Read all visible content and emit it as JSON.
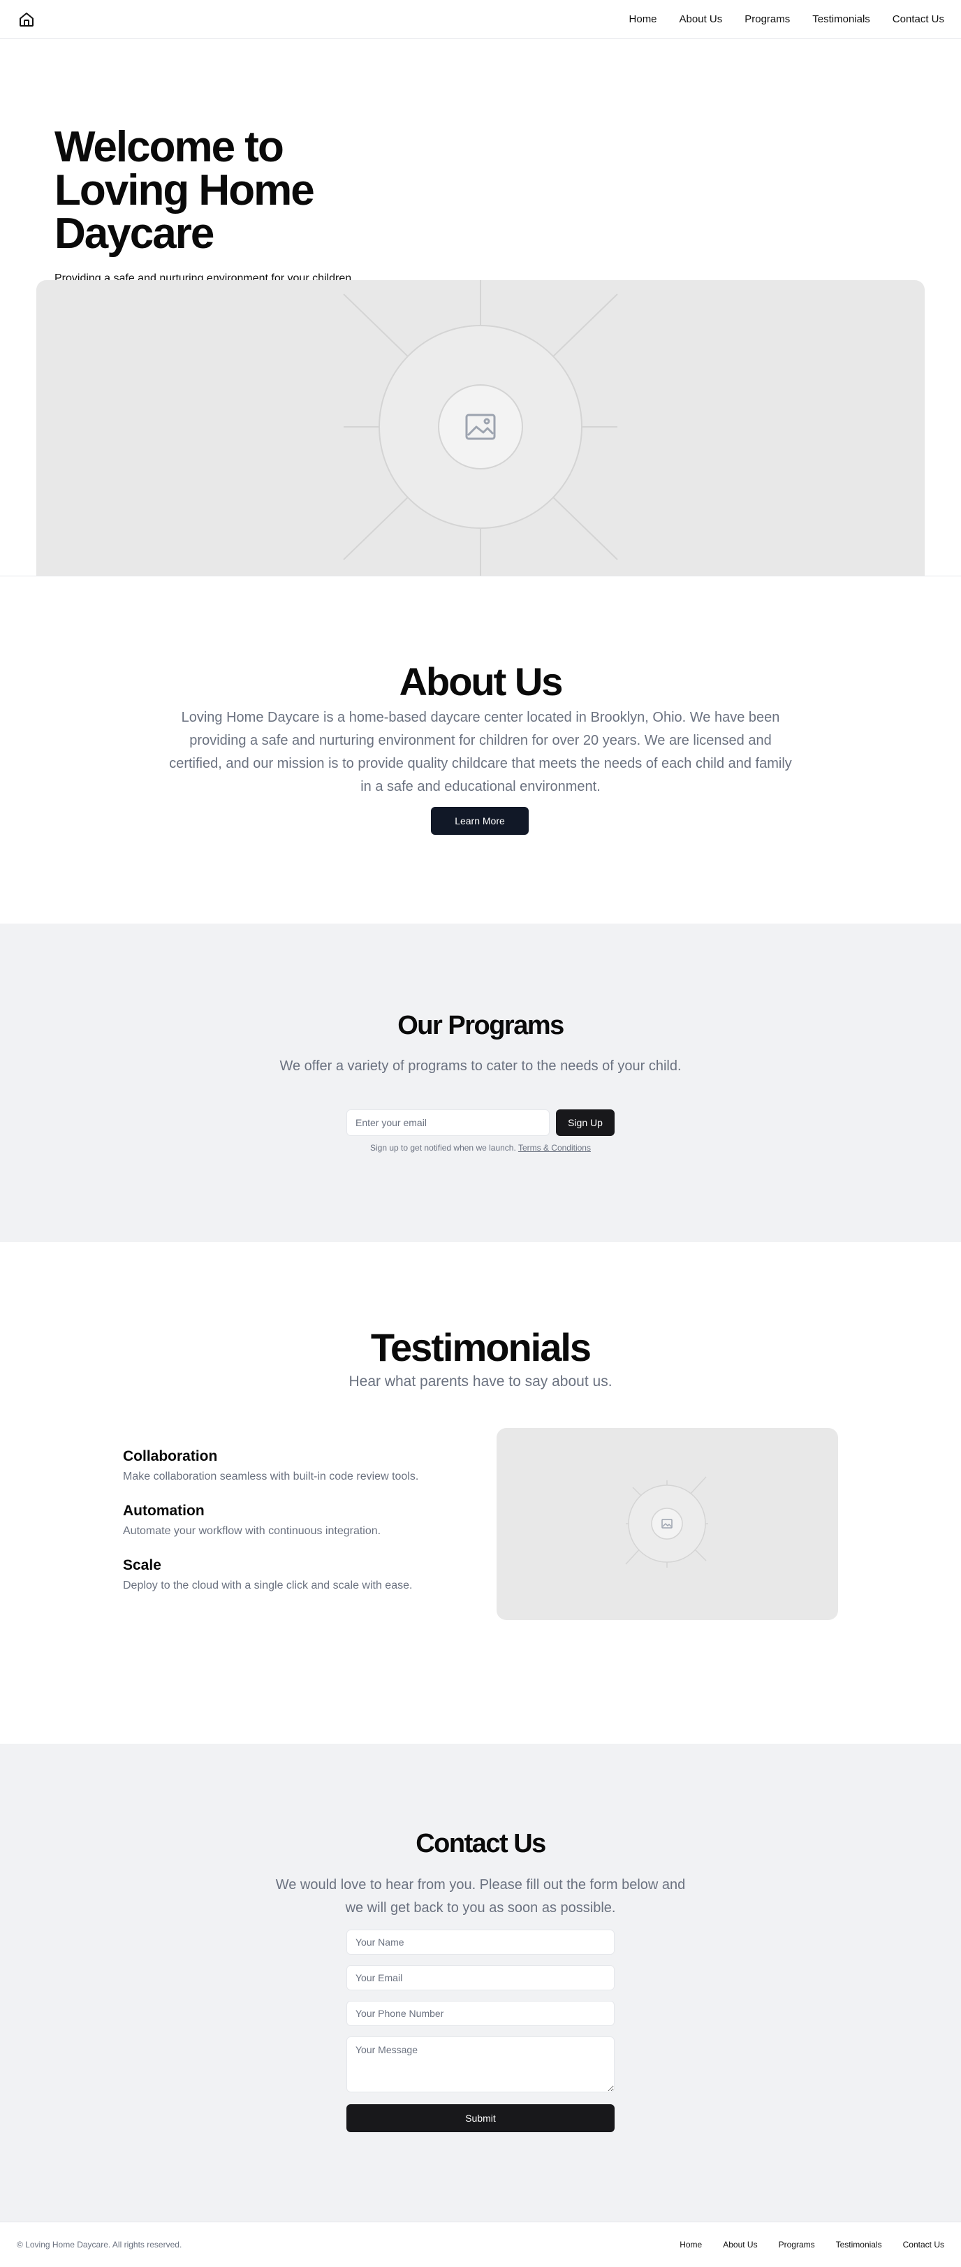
{
  "header": {
    "logo_icon": "home-icon",
    "nav": [
      {
        "label": "Home"
      },
      {
        "label": "About Us"
      },
      {
        "label": "Programs"
      },
      {
        "label": "Testimonials"
      },
      {
        "label": "Contact Us"
      }
    ]
  },
  "hero": {
    "title": "Welcome to Loving Home Daycare",
    "subtitle": "Providing a safe and nurturing environment for your children.",
    "image_icon": "image-placeholder-icon"
  },
  "about": {
    "title": "About Us",
    "text": "Loving Home Daycare is a home-based daycare center located in Brooklyn, Ohio. We have been providing a safe and nurturing environment for children for over 20 years. We are licensed and certified, and our mission is to provide quality childcare that meets the needs of each child and family in a safe and educational environment.",
    "button": "Learn More"
  },
  "programs": {
    "title": "Our Programs",
    "text": "We offer a variety of programs to cater to the needs of your child.",
    "email_placeholder": "Enter your email",
    "signup_button": "Sign Up",
    "note": "Sign up to get notified when we launch.",
    "terms_link": "Terms & Conditions"
  },
  "testimonials": {
    "title": "Testimonials",
    "subtitle": "Hear what parents have to say about us.",
    "features": [
      {
        "title": "Collaboration",
        "desc": "Make collaboration seamless with built-in code review tools."
      },
      {
        "title": "Automation",
        "desc": "Automate your workflow with continuous integration."
      },
      {
        "title": "Scale",
        "desc": "Deploy to the cloud with a single click and scale with ease."
      }
    ]
  },
  "contact": {
    "title": "Contact Us",
    "text": "We would love to hear from you. Please fill out the form below and we will get back to you as soon as possible.",
    "name_placeholder": "Your Name",
    "email_placeholder": "Your Email",
    "phone_placeholder": "Your Phone Number",
    "message_placeholder": "Your Message",
    "submit": "Submit"
  },
  "footer": {
    "copyright": "© Loving Home Daycare. All rights reserved.",
    "nav": [
      {
        "label": "Home"
      },
      {
        "label": "About Us"
      },
      {
        "label": "Programs"
      },
      {
        "label": "Testimonials"
      },
      {
        "label": "Contact Us"
      }
    ]
  }
}
